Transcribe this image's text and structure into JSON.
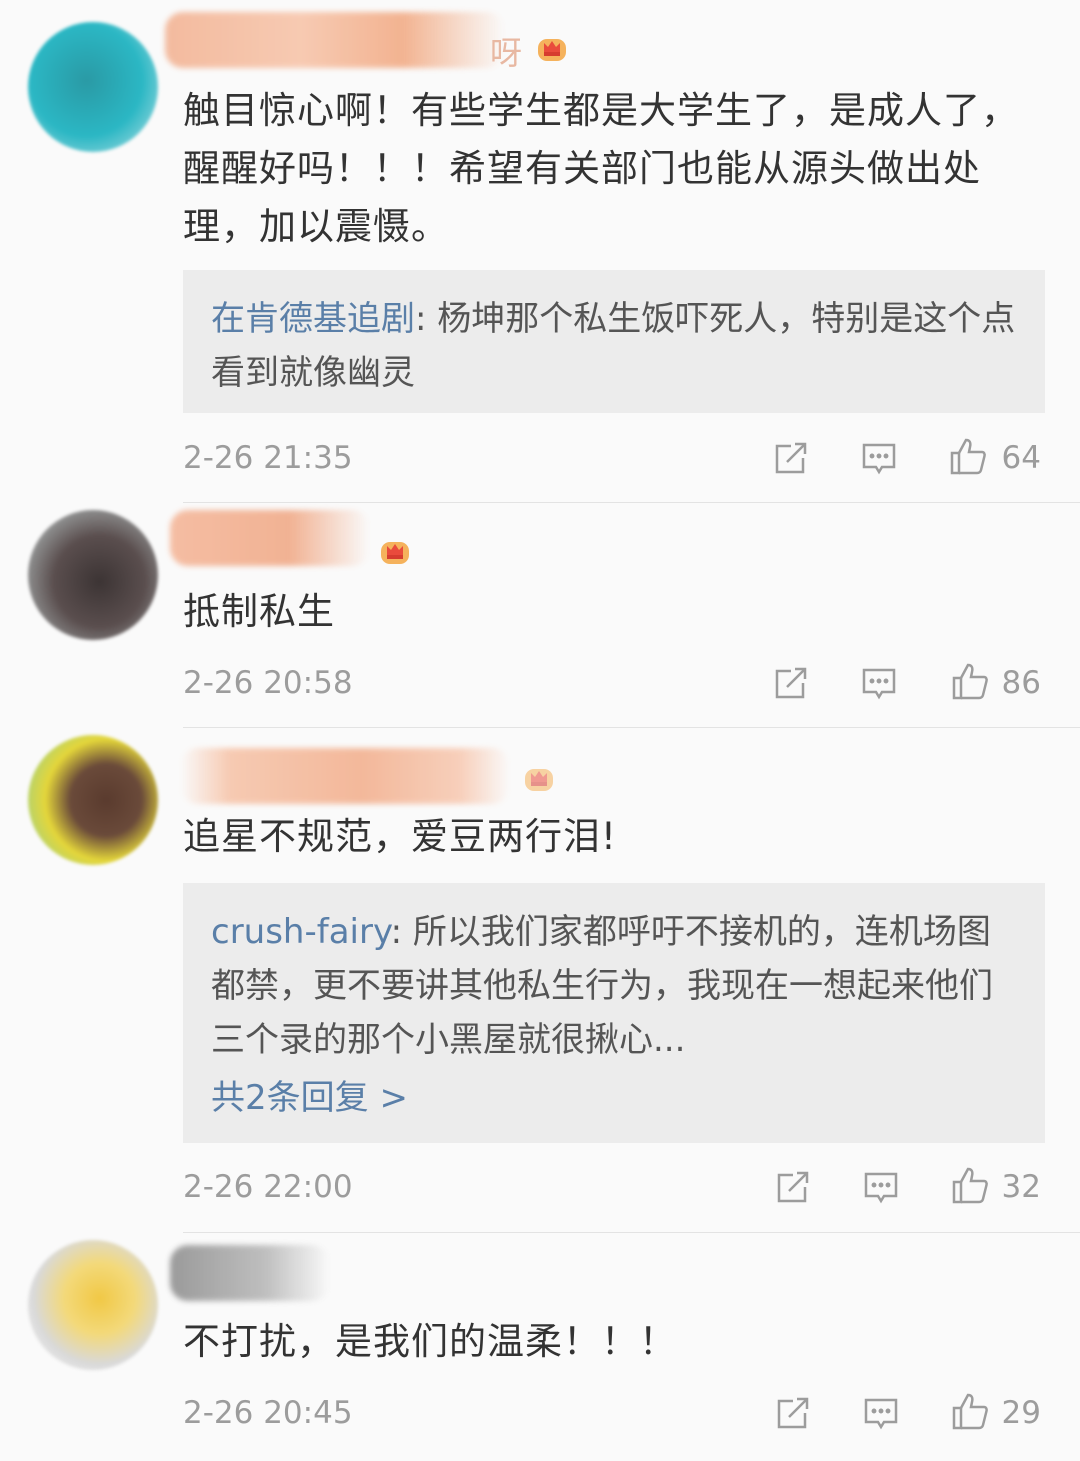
{
  "comments": [
    {
      "name_visible": "呀",
      "text": "触目惊心啊！有些学生都是大学生了，是成人了，醒醒好吗！！！希望有关部门也能从源头做出处理，加以震慑。",
      "reply": {
        "author": "在肯德基追剧",
        "text": ": 杨坤那个私生饭吓死人，特别是这个点看到就像幽灵"
      },
      "time": "2-26 21:35",
      "likes": "64"
    },
    {
      "name_visible": "",
      "text": "抵制私生",
      "time": "2-26 20:58",
      "likes": "86"
    },
    {
      "name_visible": "",
      "text": "追星不规范，爱豆两行泪!",
      "reply": {
        "author": "crush-fairy",
        "text": ": 所以我们家都呼吁不接机的，连机场图都禁，更不要讲其他私生行为，我现在一想起来他们三个录的那个小黑屋就很揪心...",
        "more": "共2条回复 >"
      },
      "time": "2-26 22:00",
      "likes": "32"
    },
    {
      "name_visible": "",
      "text": "不打扰，是我们的温柔！！！",
      "time": "2-26 20:45",
      "likes": "29"
    }
  ],
  "icons": {
    "share": "share-icon",
    "comment": "comment-icon",
    "like": "thumbs-up-icon",
    "badge": "crown-badge-icon"
  },
  "colors": {
    "link": "#5a7fa8",
    "meta": "#9c9c9c",
    "reply_bg": "#ececec"
  }
}
